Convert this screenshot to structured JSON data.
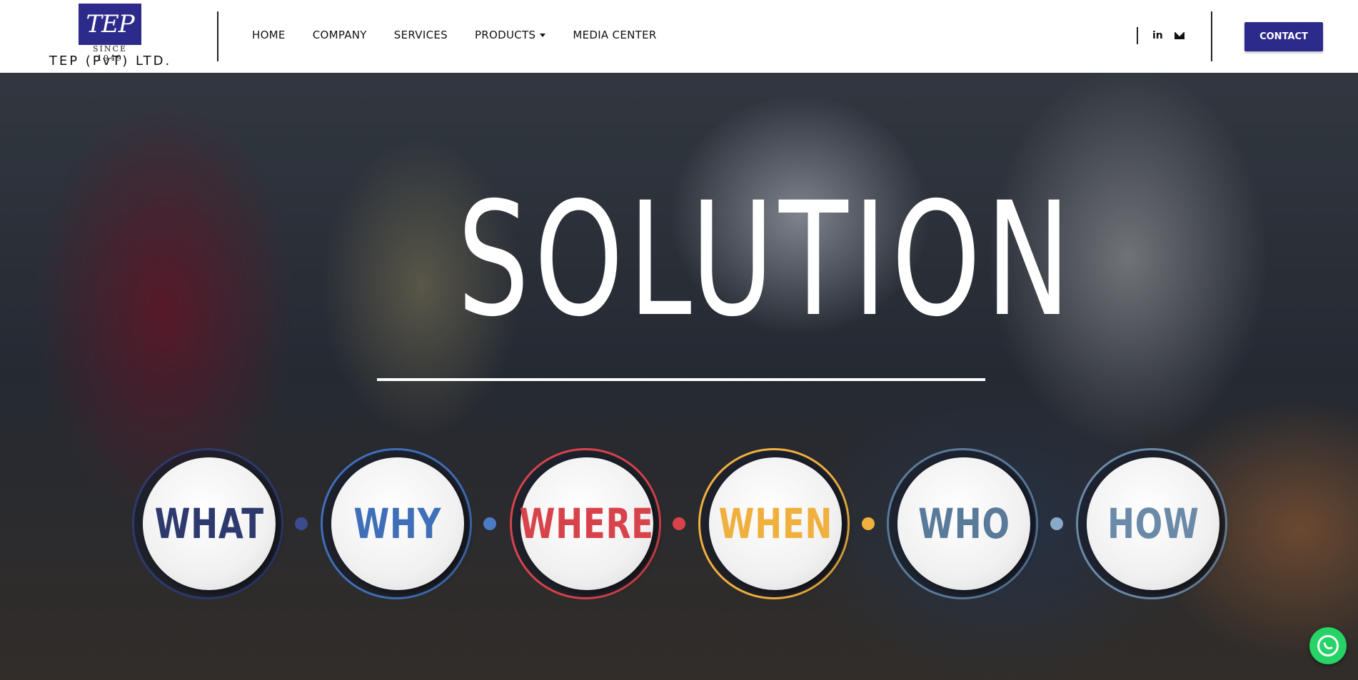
{
  "header": {
    "logo": {
      "mark": "TEP",
      "since": "SINCE 1949",
      "name": "TEP (PvT) LTD."
    },
    "nav": [
      {
        "label": "HOME"
      },
      {
        "label": "COMPANY"
      },
      {
        "label": "SERVICES"
      },
      {
        "label": "PRODUCTS"
      },
      {
        "label": "MEDIA CENTER"
      }
    ],
    "social": {
      "linkedin": "in"
    },
    "contact_label": "CONTACT"
  },
  "hero": {
    "headline": "SOLUTION",
    "circles": [
      {
        "label": "WHAT",
        "color": "#2e3a6e"
      },
      {
        "label": "WHY",
        "color": "#3f6fb8"
      },
      {
        "label": "WHERE",
        "color": "#d8434b"
      },
      {
        "label": "WHEN",
        "color": "#f0b03e"
      },
      {
        "label": "WHO",
        "color": "#5a7a9a"
      },
      {
        "label": "HOW",
        "color": "#6a8aa8"
      }
    ],
    "connector_colors": [
      "#3a4c8f",
      "#4a7cc6",
      "#d8434b",
      "#f0b03e",
      "#8aa8c8"
    ]
  },
  "colors": {
    "brand": "#2c2a8a",
    "whatsapp": "#25d366"
  }
}
